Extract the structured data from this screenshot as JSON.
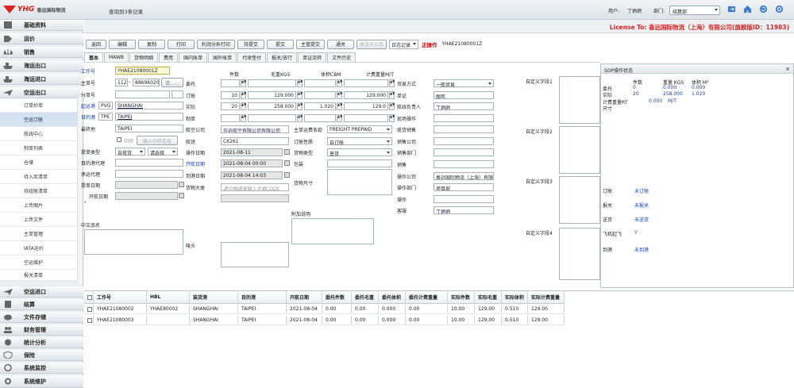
{
  "header": {
    "logo_en": "YHG",
    "logo_cn": "香远国际物流",
    "record_info": "查询到3条记录",
    "user_label": "用户:",
    "user_name": "丁炳炳",
    "dept_label": "部门:",
    "dept_value": "结算部"
  },
  "license": "License To: 香远国际物流（上海）有限公司(旗舰版ID：11983)",
  "sidebar": {
    "sections_top": [
      {
        "label": "基础资料",
        "icon": "database-icon"
      },
      {
        "label": "运价",
        "icon": "price-tag-icon"
      },
      {
        "label": "销售",
        "icon": "scale-icon"
      },
      {
        "label": "海运出口",
        "icon": "ship-icon"
      },
      {
        "label": "海运进口",
        "icon": "ship-icon"
      },
      {
        "label": "空运出口",
        "icon": "plane-icon"
      }
    ],
    "sub_items": [
      "订单抄单",
      "空运订舱",
      "航线中心",
      "制单列表",
      "仓储",
      "待入库清单",
      "待组舱清单",
      "上传图片",
      "上传文件",
      "主单管理",
      "IATA运价",
      "空运维护",
      "报关清单"
    ],
    "sections_bottom": [
      {
        "label": "空运进口",
        "icon": "plane-icon"
      },
      {
        "label": "结算",
        "icon": "calculator-icon"
      },
      {
        "label": "文件存储",
        "icon": "cloud-icon"
      },
      {
        "label": "财务管理",
        "icon": "people-icon"
      },
      {
        "label": "统计分析",
        "icon": "pie-chart-icon"
      },
      {
        "label": "保险",
        "icon": "shield-icon"
      },
      {
        "label": "系统监控",
        "icon": "monitor-icon"
      },
      {
        "label": "系统维护",
        "icon": "gear-icon"
      }
    ]
  },
  "toolbar": {
    "buttons": [
      "返回",
      "编辑",
      "复制",
      "打印",
      "利润分析打印",
      "持提交",
      "提交",
      "主管提交",
      "通关"
    ],
    "disabled": "发送分公司",
    "log_select": "日志记录",
    "status": "正操作",
    "code": "YHAE21080001Z"
  },
  "tabs": [
    "基本",
    "MAWB",
    "货物明细",
    "费用",
    "国内账单",
    "国外账单",
    "代收垫付",
    "报关/放行",
    "单证流转",
    "文件历史"
  ],
  "form": {
    "col1": {
      "job_no_label": "工作号",
      "job_no": "YHAE21080001Z",
      "mawb_label": "主单号",
      "mawb_prefix": "112",
      "mawb_no": "88696020",
      "mawb_btn": "请……",
      "hawb_label": "分单号",
      "origin_label": "起运港",
      "origin_code": "PVG",
      "origin_name": "SHANGHAI",
      "dest_label": "目的港",
      "dest_code": "TPE",
      "dest_name": "TAIPEI",
      "final_label": "最终地",
      "final_value": "TAIPEI",
      "transfer_label": "中转",
      "transfer_btn": "输入中转信息",
      "bill_type_label": "提单类型",
      "bill_type_1": "自揽货",
      "bill_type_2": "请选择",
      "dest_agent_label": "目的港代理",
      "carrier_agent_label": "承运代理",
      "invoice_date_label": "提单日期",
      "sail_date_label": "开航日期",
      "goods_name_label": "中文品名",
      "shipping_mark_label": "唛头"
    },
    "col2": {
      "pieces_label": "件数",
      "weight_label": "毛重KGS",
      "volume_label": "体积CBM",
      "charge_label": "计费重量M/T",
      "consign_label": "委托",
      "booking_label": "订舱",
      "booking_pcs": "10",
      "booking_wt": "129.000",
      "booking_charge": "129.000",
      "actual_label": "实际",
      "actual_pcs": "20",
      "actual_wt": "258.000",
      "actual_vol": "1.020",
      "actual_charge": "129.0",
      "mode_label": "制单",
      "airline_label": "航空公司",
      "airline_value": "华运航空有限公司有限公司",
      "flight_label": "航班",
      "flight_value": "CK261",
      "op_date_label": "操作日期",
      "op_date": "2021-08-11",
      "sail_label": "开航日期",
      "sail_date": "2021-08-04 00:00",
      "arrive_label": "到港日期",
      "arrive_date": "2021-08-04 14:03",
      "cargo_class_label": "货物大类",
      "cargo_class_ph": "请空格或者输入大类CODE"
    },
    "col3": {
      "freight_label": "主单运费条款",
      "freight_value": "FREIGHT PREPAID",
      "booking_nature_label": "订舱性质",
      "booking_nature_value": "自订舱",
      "cargo_type_label": "货物类型",
      "cargo_type_value": "普货",
      "package_label": "包装",
      "dims_label": "货物尺寸",
      "remark_label": "附加说明"
    },
    "col4": {
      "trade_label": "贸易方式",
      "trade_value": "一般贸易",
      "sale_label": "单证",
      "sale_value": "图苑",
      "route_label": "航线负责人",
      "route_value": "丁炳炳",
      "site_label": "现场操作",
      "pickup_label": "揽货销售",
      "sales_co_label": "销售公司",
      "sales_dept_label": "销售部门",
      "salesman_label": "销售",
      "op_co_label": "操作公司",
      "op_co_value": "香远国际物流（上海）有限公司",
      "op_dept_label": "操作部门",
      "op_dept_value": "项目部",
      "operator_label": "操作",
      "service_label": "客服",
      "service_value": "丁炳炳"
    },
    "custom": [
      "自定义字段1",
      "自定义字段2",
      "自定义字段3",
      "自定义字段4"
    ]
  },
  "sop": {
    "title": "SOP操作状态",
    "head": [
      "件数",
      "重量 KGS",
      "体积 M³"
    ],
    "rows": [
      {
        "label": "委托",
        "v": [
          "0",
          "0.000",
          "0.000"
        ]
      },
      {
        "label": "实际",
        "v": [
          "20",
          "258.000",
          "1.020"
        ]
      },
      {
        "label": "计费重量RT",
        "v": [
          "",
          "0.000",
          "M/T"
        ]
      },
      {
        "label": "尺寸",
        "v": [
          "",
          "",
          ""
        ]
      }
    ],
    "status": [
      {
        "label": "订舱",
        "value": "未订舱"
      },
      {
        "label": "报关",
        "value": "未报关"
      },
      {
        "label": "送货",
        "value": "未送货"
      },
      {
        "label": "飞机起飞",
        "value": "Y"
      },
      {
        "label": "到港",
        "value": "未到港"
      }
    ]
  },
  "grid": {
    "headers": [
      "工作号",
      "HBL",
      "装货港",
      "目的港",
      "开航日期",
      "委托件数",
      "委托毛重",
      "委托体积",
      "委托计费重量",
      "实际件数",
      "实际毛重",
      "实际体积",
      "实际计费重量"
    ],
    "rows": [
      [
        "YHAE21080002",
        "YHAE80002",
        "SHANGHAI",
        "TAIPEI",
        "2021-08-04",
        "0.00",
        "0.00",
        "0.000",
        "0.00",
        "10.00",
        "129.00",
        "0.510",
        "129.00"
      ],
      [
        "YHAE21080003",
        "",
        "SHANGHAI",
        "TAIPEI",
        "2021-08-04",
        "0.00",
        "0.00",
        "0.000",
        "0.00",
        "10.00",
        "129.00",
        "0.510",
        "129.00"
      ]
    ]
  }
}
